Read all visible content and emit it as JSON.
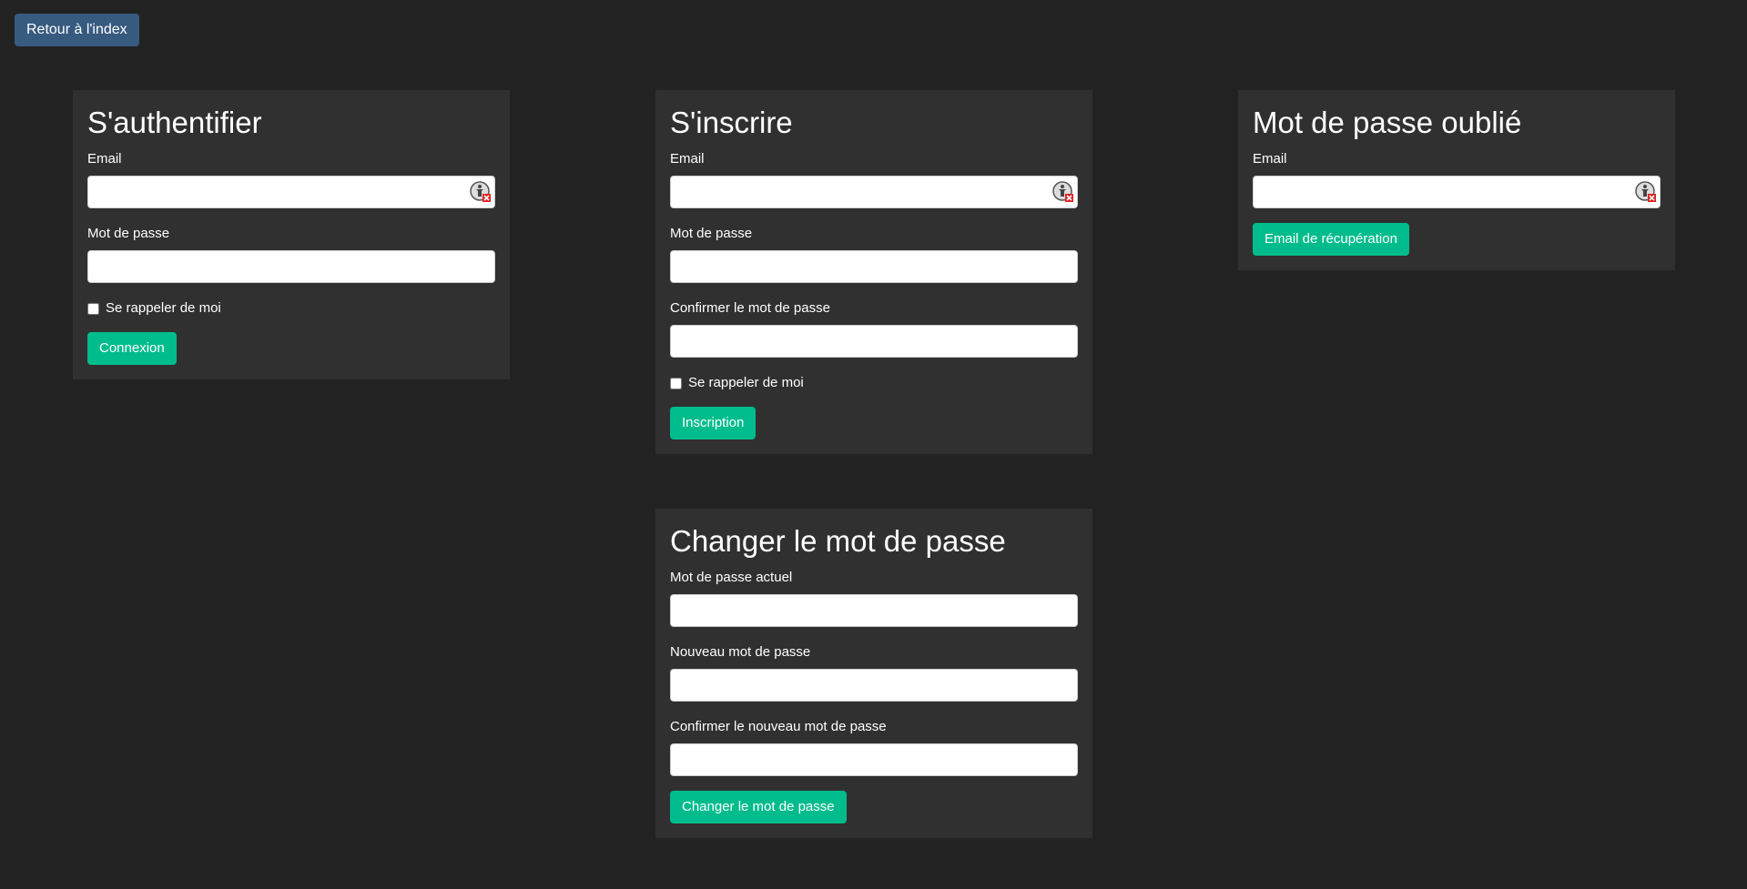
{
  "nav": {
    "back_label": "Retour à l'index"
  },
  "icons": {
    "password_manager": "password-manager-icon"
  },
  "colors": {
    "primary": "#375a7f",
    "success": "#00bc8c",
    "background": "#222222",
    "panel": "#303030"
  },
  "login": {
    "title": "S'authentifier",
    "email_label": "Email",
    "email_value": "",
    "password_label": "Mot de passe",
    "password_value": "",
    "remember_label": "Se rappeler de moi",
    "submit_label": "Connexion"
  },
  "register": {
    "title": "S'inscrire",
    "email_label": "Email",
    "email_value": "",
    "password_label": "Mot de passe",
    "password_value": "",
    "confirm_label": "Confirmer le mot de passe",
    "confirm_value": "",
    "remember_label": "Se rappeler de moi",
    "submit_label": "Inscription"
  },
  "forgot": {
    "title": "Mot de passe oublié",
    "email_label": "Email",
    "email_value": "",
    "submit_label": "Email de récupération"
  },
  "change": {
    "title": "Changer le mot de passe",
    "current_label": "Mot de passe actuel",
    "current_value": "",
    "new_label": "Nouveau mot de passe",
    "new_value": "",
    "confirm_label": "Confirmer le nouveau mot de passe",
    "confirm_value": "",
    "submit_label": "Changer le mot de passe"
  }
}
